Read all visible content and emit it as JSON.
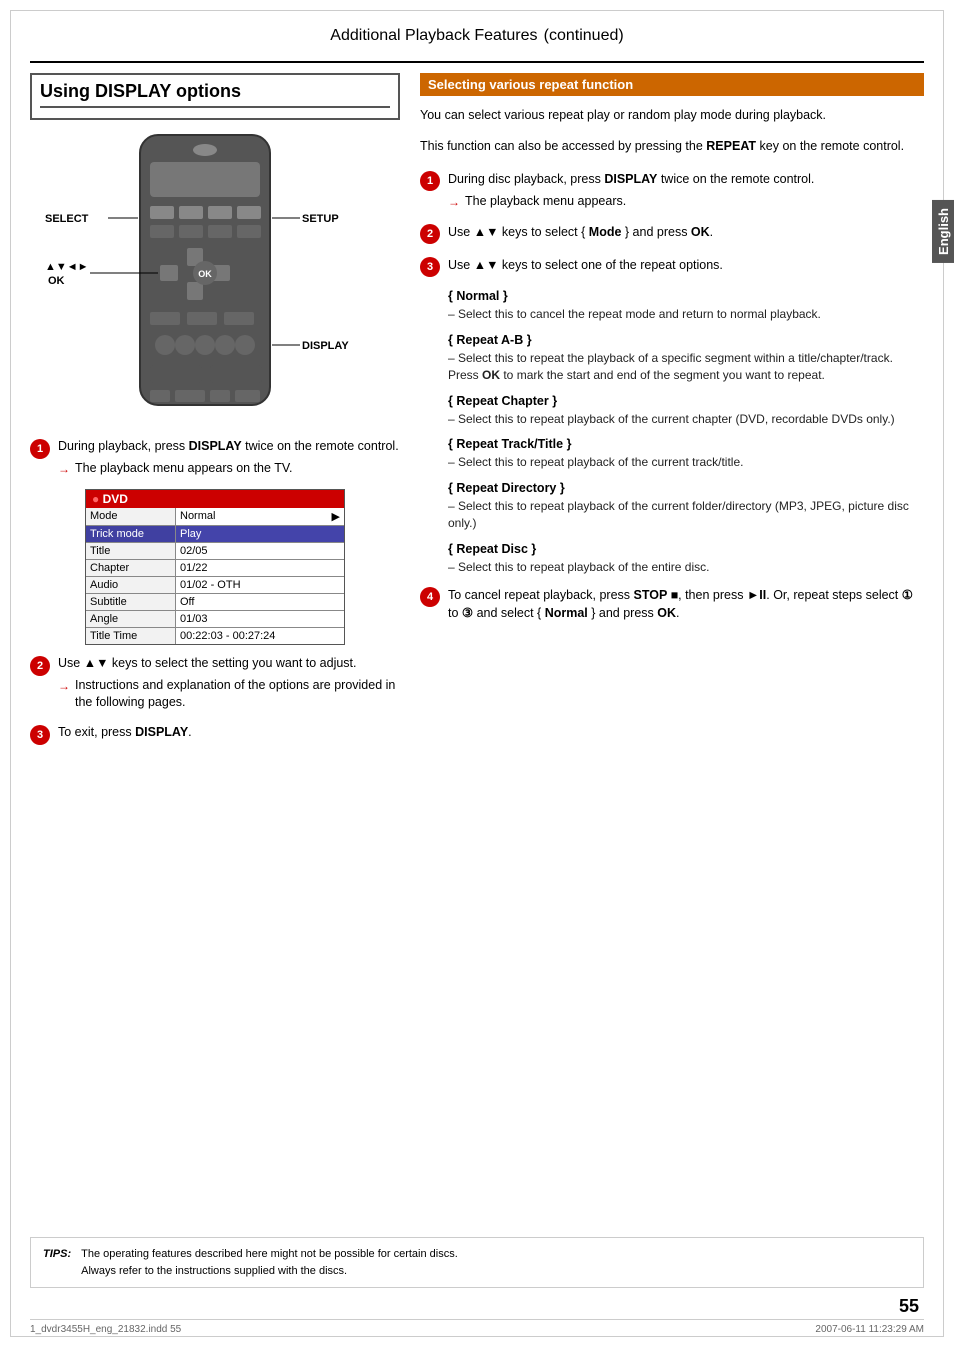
{
  "page": {
    "title": "Additional Playback Features",
    "title_suffix": "(continued)",
    "page_number": "55",
    "footer_file": "1_dvdr3455H_eng_21832.indd  55",
    "footer_date": "2007-06-11   11:23:29 AM"
  },
  "left": {
    "section_title": "Using DISPLAY options",
    "diagram_labels": {
      "select": "SELECT",
      "dpad": "▲▼◄►",
      "ok": "OK",
      "setup": "SETUP",
      "display": "DISPLAY"
    },
    "menu_table": {
      "header": "DVD",
      "rows": [
        {
          "label": "Mode",
          "value": "Normal",
          "arrow": "▶",
          "highlight": false
        },
        {
          "label": "Trick mode",
          "value": "Play",
          "arrow": "",
          "highlight": true
        },
        {
          "label": "Title",
          "value": "02/05",
          "arrow": "",
          "highlight": false
        },
        {
          "label": "Chapter",
          "value": "01/22",
          "arrow": "",
          "highlight": false
        },
        {
          "label": "Audio",
          "value": "01/02 - OTH",
          "arrow": "",
          "highlight": false
        },
        {
          "label": "Subtitle",
          "value": "Off",
          "arrow": "",
          "highlight": false
        },
        {
          "label": "Angle",
          "value": "01/03",
          "arrow": "",
          "highlight": false
        },
        {
          "label": "Title Time",
          "value": "00:22:03 - 00:27:24",
          "arrow": "",
          "highlight": false
        }
      ]
    },
    "steps": [
      {
        "number": "1",
        "text": "During playback, press ",
        "bold": "DISPLAY",
        "text2": " twice on the remote control.",
        "sub": "The playback menu appears on the TV."
      },
      {
        "number": "2",
        "text": "Use ",
        "bold": "▲▼",
        "text2": " keys to select the setting you want to adjust.",
        "sub": "Instructions and explanation of the options are provided in the following pages."
      },
      {
        "number": "3",
        "text": "To exit, press ",
        "bold": "DISPLAY",
        "text2": "."
      }
    ]
  },
  "right": {
    "section_title": "Selecting various repeat function",
    "intro": "You can select various repeat play or random play mode during playback.",
    "function_access": "This function can also be accessed by pressing the REPEAT key on the remote control.",
    "function_access_bold": "REPEAT",
    "steps": [
      {
        "number": "1",
        "text": "During disc playback, press ",
        "bold": "DISPLAY",
        "text2": " twice on the remote control.",
        "sub": "The playback menu appears."
      },
      {
        "number": "2",
        "text": "Use ",
        "bold": "▲▼",
        "text2": " keys to select { ",
        "bold2": "Mode",
        "text3": " } and press ",
        "bold3": "OK",
        "text4": "."
      },
      {
        "number": "3",
        "text": "Use ",
        "bold": "▲▼",
        "text2": " keys to select one of the repeat options."
      }
    ],
    "repeat_options": [
      {
        "title": "{ Normal }",
        "desc": "– Select this to cancel the repeat mode and return to normal playback."
      },
      {
        "title": "{ Repeat A-B }",
        "desc": "– Select this to repeat the playback of a specific segment within a title/chapter/track. Press OK to mark the start and end of the segment you want to repeat."
      },
      {
        "title": "{ Repeat Chapter }",
        "desc": "– Select this to repeat playback of the current chapter (DVD, recordable DVDs only.)"
      },
      {
        "title": "{ Repeat Track/Title }",
        "desc": "– Select this to repeat playback of the current track/title."
      },
      {
        "title": "{ Repeat Directory }",
        "desc": "– Select this to repeat playback of the current folder/directory (MP3, JPEG, picture disc only.)"
      },
      {
        "title": "{ Repeat Disc }",
        "desc": "– Select this to repeat playback of the entire disc."
      }
    ],
    "step4": {
      "text": "To cancel repeat playback, press ",
      "bold1": "STOP ■",
      "text2": ", then press ",
      "bold2": "►II",
      "text3": ". Or, repeat steps select ",
      "bold3": "①",
      "text4": " to ",
      "bold4": "③",
      "text5": " and select { ",
      "bold5": "Normal",
      "text6": " } and press ",
      "bold6": "OK",
      "text7": "."
    }
  },
  "english_tab": "English",
  "tips": {
    "label": "TIPS:",
    "text": "The operating features described here might not be possible for certain discs.\nAlways refer to the instructions supplied with the discs."
  }
}
